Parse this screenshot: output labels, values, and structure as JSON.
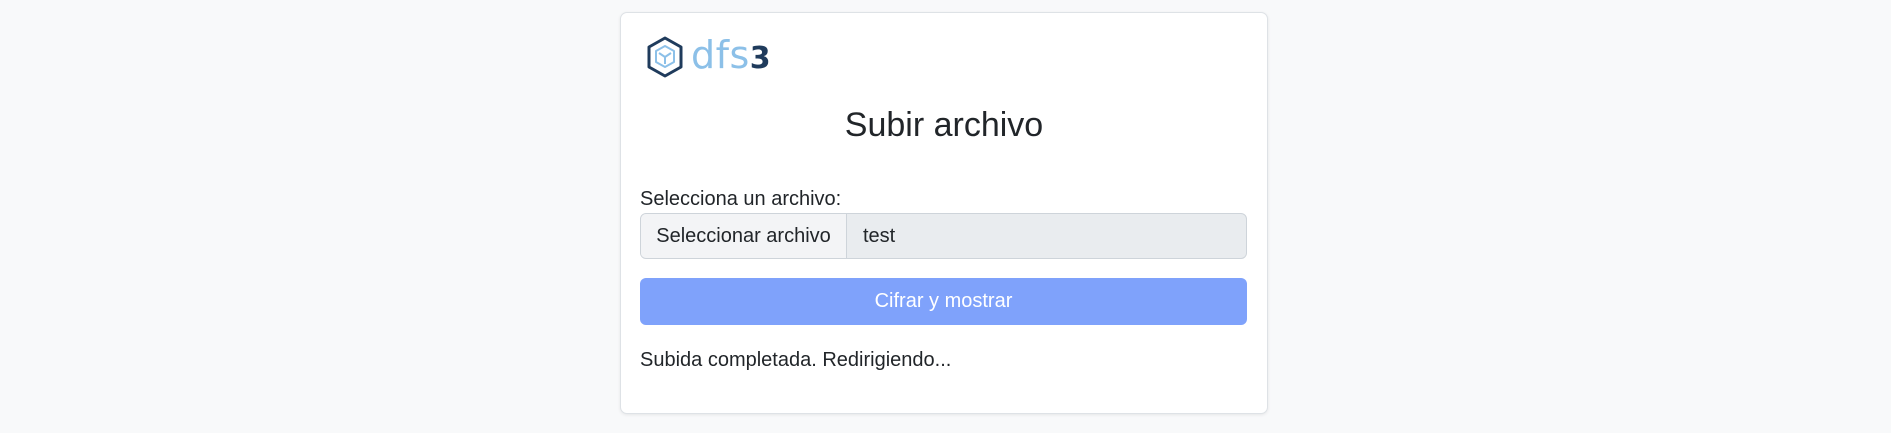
{
  "brand": {
    "logo_text": "dfs",
    "logo_number": "3",
    "colors": {
      "logo_light": "#8cc0e8",
      "logo_dark": "#1f3b5c"
    }
  },
  "page": {
    "title": "Subir archivo"
  },
  "form": {
    "file_label": "Selecciona un archivo:",
    "file_button_label": "Seleccionar archivo",
    "file_name": "test",
    "submit_label": "Cifrar y mostrar",
    "submit_color": "#7fa2fb",
    "submit_disabled": true
  },
  "status": {
    "message": "Subida completada. Redirigiendo..."
  }
}
